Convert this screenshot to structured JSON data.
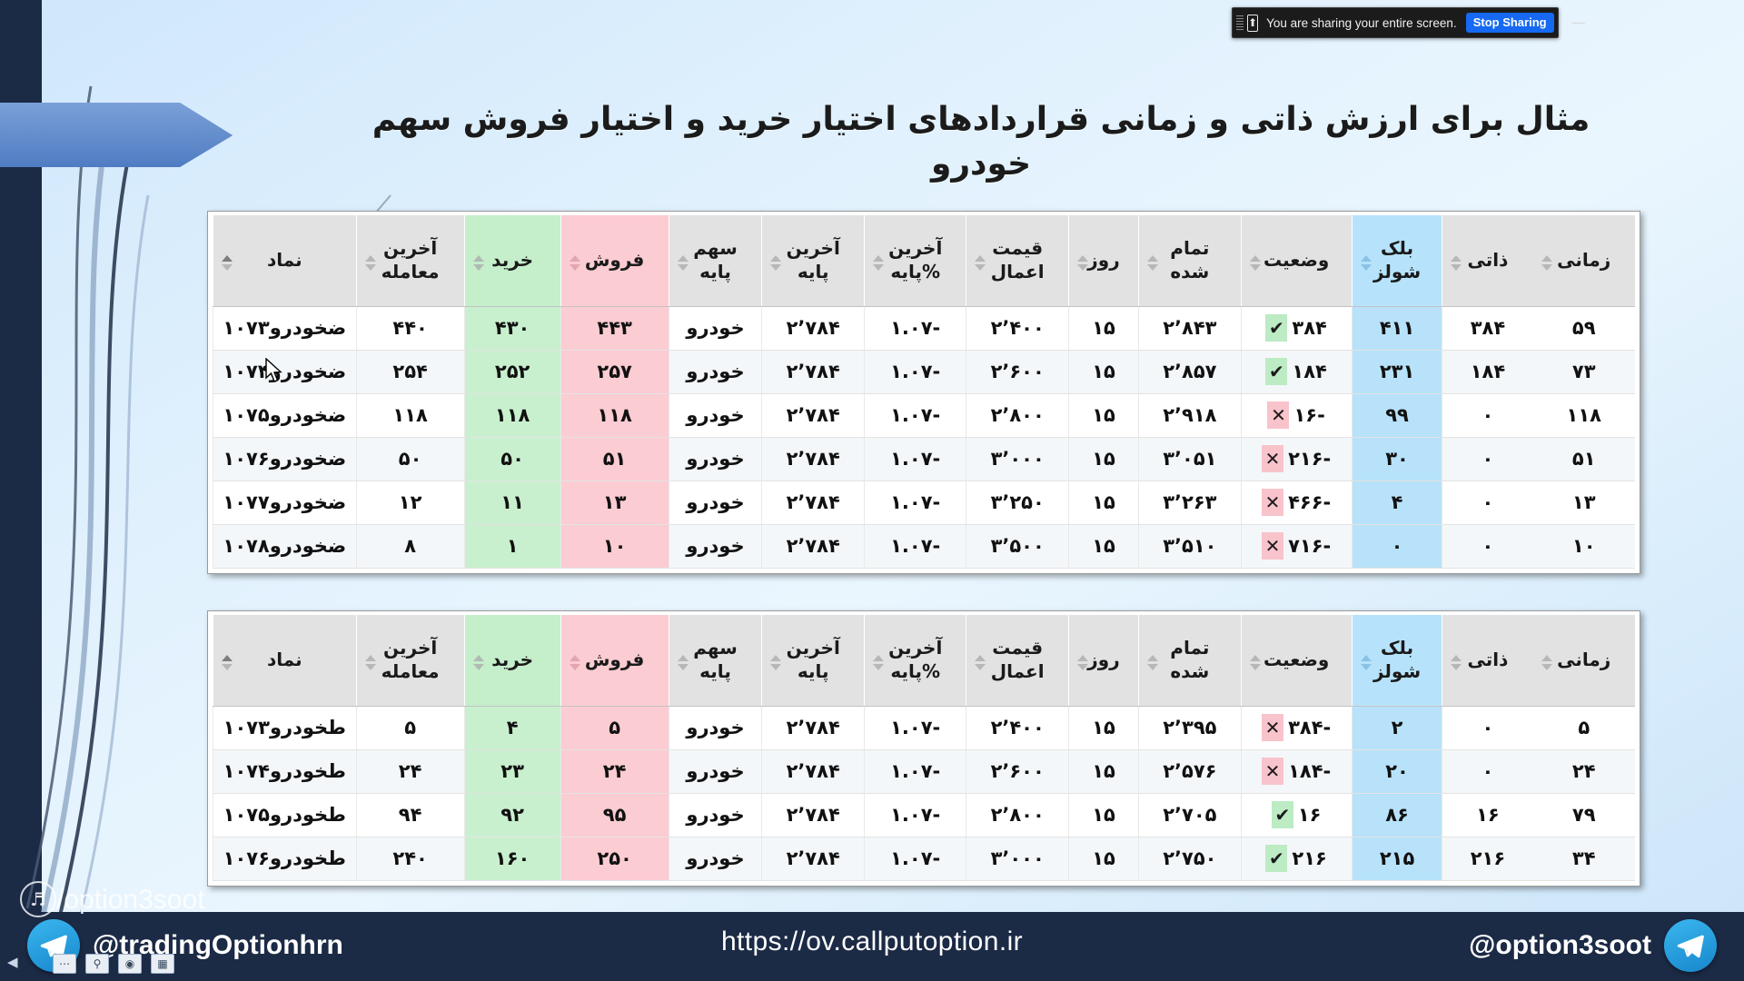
{
  "share_bar": {
    "message": "You are sharing your entire screen.",
    "stop_label": "Stop Sharing",
    "minimize_label": "—",
    "camera_icon": "screen-share-icon",
    "grip_icon": "drag-grip-icon"
  },
  "slide": {
    "title": "مثال برای ارزش ذاتی و زمانی قراردادهای اختیار خرید و اختیار فروش سهم خودرو"
  },
  "table_headers": [
    {
      "label": "زمانی",
      "line1": "زمانی",
      "line2": "",
      "tone": "plain"
    },
    {
      "label": "ذاتی",
      "line1": "ذاتی",
      "line2": "",
      "tone": "plain"
    },
    {
      "label": "بلک شولز",
      "line1": "بلک",
      "line2": "شولز",
      "tone": "blue"
    },
    {
      "label": "وضعیت",
      "line1": "وضعیت",
      "line2": "",
      "tone": "plain"
    },
    {
      "label": "تمام شده",
      "line1": "تمام",
      "line2": "شده",
      "tone": "plain"
    },
    {
      "label": "روز",
      "line1": "روز",
      "line2": "",
      "tone": "plain"
    },
    {
      "label": "قیمت اعمال",
      "line1": "قیمت",
      "line2": "اعمال",
      "tone": "plain"
    },
    {
      "label": "آخرین %پایه",
      "line1": "آخرین",
      "line2": "%پایه",
      "tone": "plain"
    },
    {
      "label": "آخرین پایه",
      "line1": "آخرین",
      "line2": "پایه",
      "tone": "plain"
    },
    {
      "label": "سهم پایه",
      "line1": "سهم",
      "line2": "پایه",
      "tone": "plain"
    },
    {
      "label": "فروش",
      "line1": "فروش",
      "line2": "",
      "tone": "pink"
    },
    {
      "label": "خرید",
      "line1": "خرید",
      "line2": "",
      "tone": "green"
    },
    {
      "label": "آخرین معامله",
      "line1": "آخرین",
      "line2": "معامله",
      "tone": "plain"
    },
    {
      "label": "نماد",
      "line1": "نماد",
      "line2": "",
      "tone": "plain"
    }
  ],
  "table1": {
    "name": "call-options-table",
    "rows": [
      {
        "time_value": "۵۹",
        "intrinsic": "۳۸۴",
        "black_scholes": "۴۱۱",
        "status_mark": "ok",
        "status": "۳۸۴",
        "breakeven": "۲٬۸۴۳",
        "days": "۱۵",
        "strike": "۲٬۴۰۰",
        "base_pct": "-۱.۰۷",
        "base_last": "۲٬۷۸۴",
        "base_symbol": "خودرو",
        "sell": "۴۴۳",
        "buy": "۴۳۰",
        "last_trade": "۴۴۰",
        "symbol": "ضخودرو۱۰۷۳"
      },
      {
        "time_value": "۷۳",
        "intrinsic": "۱۸۴",
        "black_scholes": "۲۳۱",
        "status_mark": "ok",
        "status": "۱۸۴",
        "breakeven": "۲٬۸۵۷",
        "days": "۱۵",
        "strike": "۲٬۶۰۰",
        "base_pct": "-۱.۰۷",
        "base_last": "۲٬۷۸۴",
        "base_symbol": "خودرو",
        "sell": "۲۵۷",
        "buy": "۲۵۲",
        "last_trade": "۲۵۴",
        "symbol": "ضخودرو۱۰۷۴"
      },
      {
        "time_value": "۱۱۸",
        "intrinsic": "۰",
        "black_scholes": "۹۹",
        "status_mark": "no",
        "status": "-۱۶",
        "breakeven": "۲٬۹۱۸",
        "days": "۱۵",
        "strike": "۲٬۸۰۰",
        "base_pct": "-۱.۰۷",
        "base_last": "۲٬۷۸۴",
        "base_symbol": "خودرو",
        "sell": "۱۱۸",
        "buy": "۱۱۸",
        "last_trade": "۱۱۸",
        "symbol": "ضخودرو۱۰۷۵"
      },
      {
        "time_value": "۵۱",
        "intrinsic": "۰",
        "black_scholes": "۳۰",
        "status_mark": "no",
        "status": "-۲۱۶",
        "breakeven": "۳٬۰۵۱",
        "days": "۱۵",
        "strike": "۳٬۰۰۰",
        "base_pct": "-۱.۰۷",
        "base_last": "۲٬۷۸۴",
        "base_symbol": "خودرو",
        "sell": "۵۱",
        "buy": "۵۰",
        "last_trade": "۵۰",
        "symbol": "ضخودرو۱۰۷۶"
      },
      {
        "time_value": "۱۳",
        "intrinsic": "۰",
        "black_scholes": "۴",
        "status_mark": "no",
        "status": "-۴۶۶",
        "breakeven": "۳٬۲۶۳",
        "days": "۱۵",
        "strike": "۳٬۲۵۰",
        "base_pct": "-۱.۰۷",
        "base_last": "۲٬۷۸۴",
        "base_symbol": "خودرو",
        "sell": "۱۳",
        "buy": "۱۱",
        "last_trade": "۱۲",
        "symbol": "ضخودرو۱۰۷۷"
      },
      {
        "time_value": "۱۰",
        "intrinsic": "۰",
        "black_scholes": "۰",
        "status_mark": "no",
        "status": "-۷۱۶",
        "breakeven": "۳٬۵۱۰",
        "days": "۱۵",
        "strike": "۳٬۵۰۰",
        "base_pct": "-۱.۰۷",
        "base_last": "۲٬۷۸۴",
        "base_symbol": "خودرو",
        "sell": "۱۰",
        "buy": "۱",
        "last_trade": "۸",
        "symbol": "ضخودرو۱۰۷۸"
      }
    ]
  },
  "table2": {
    "name": "put-options-table",
    "rows": [
      {
        "time_value": "۵",
        "intrinsic": "۰",
        "black_scholes": "۲",
        "status_mark": "no",
        "status": "-۳۸۴",
        "breakeven": "۲٬۳۹۵",
        "days": "۱۵",
        "strike": "۲٬۴۰۰",
        "base_pct": "-۱.۰۷",
        "base_last": "۲٬۷۸۴",
        "base_symbol": "خودرو",
        "sell": "۵",
        "buy": "۴",
        "last_trade": "۵",
        "symbol": "طخودرو۱۰۷۳"
      },
      {
        "time_value": "۲۴",
        "intrinsic": "۰",
        "black_scholes": "۲۰",
        "status_mark": "no",
        "status": "-۱۸۴",
        "breakeven": "۲٬۵۷۶",
        "days": "۱۵",
        "strike": "۲٬۶۰۰",
        "base_pct": "-۱.۰۷",
        "base_last": "۲٬۷۸۴",
        "base_symbol": "خودرو",
        "sell": "۲۴",
        "buy": "۲۳",
        "last_trade": "۲۴",
        "symbol": "طخودرو۱۰۷۴"
      },
      {
        "time_value": "۷۹",
        "intrinsic": "۱۶",
        "black_scholes": "۸۶",
        "status_mark": "ok",
        "status": "۱۶",
        "breakeven": "۲٬۷۰۵",
        "days": "۱۵",
        "strike": "۲٬۸۰۰",
        "base_pct": "-۱.۰۷",
        "base_last": "۲٬۷۸۴",
        "base_symbol": "خودرو",
        "sell": "۹۵",
        "buy": "۹۲",
        "last_trade": "۹۴",
        "symbol": "طخودرو۱۰۷۵"
      },
      {
        "time_value": "۳۴",
        "intrinsic": "۲۱۶",
        "black_scholes": "۲۱۵",
        "status_mark": "ok",
        "status": "۲۱۶",
        "breakeven": "۲٬۷۵۰",
        "days": "۱۵",
        "strike": "۳٬۰۰۰",
        "base_pct": "-۱.۰۷",
        "base_last": "۲٬۷۸۴",
        "base_symbol": "خودرو",
        "sell": "۲۵۰",
        "buy": "۱۶۰",
        "last_trade": "۲۴۰",
        "symbol": "طخودرو۱۰۷۶"
      }
    ]
  },
  "footer": {
    "url": "https://ov.callputoption.ir",
    "telegram_left": "@tradingOptionhrn",
    "telegram_right": "@option3soot",
    "watermark": "/option3soot"
  },
  "colors": {
    "accent_blue": "#1273c4",
    "highlight_blue": "#b8e2fa",
    "sell_pink": "#fbccd2",
    "buy_green": "#c9f0ce",
    "negative_red": "#d01a1a",
    "footer_navy": "#1b2a45"
  }
}
